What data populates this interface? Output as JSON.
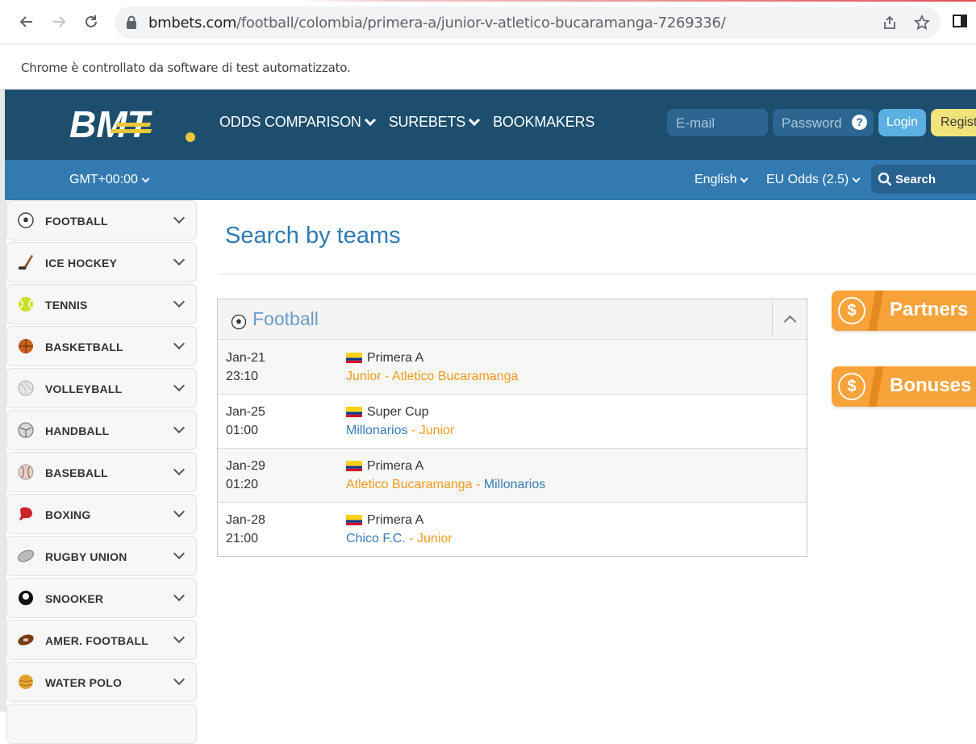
{
  "browser": {
    "url_host": "bmbets.com",
    "url_path": "/football/colombia/primera-a/junior-v-atletico-bucaramanga-7269336/",
    "automation_notice": "Chrome è controllato da software di test automatizzato."
  },
  "header": {
    "logo_text": "BMT",
    "nav": [
      {
        "label": "ODDS COMPARISON",
        "has_dropdown": true
      },
      {
        "label": "SUREBETS",
        "has_dropdown": true
      },
      {
        "label": "BOOKMAKERS",
        "has_dropdown": false
      }
    ],
    "email_placeholder": "E-mail",
    "password_placeholder": "Password",
    "help_glyph": "?",
    "login_label": "Login",
    "register_label": "Registe"
  },
  "subheader": {
    "timezone": "GMT+00:00",
    "language": "English",
    "odds_format": "EU Odds (2.5)",
    "search_label": "Search"
  },
  "sidebar": {
    "items": [
      {
        "label": "FOOTBALL",
        "icon": "soccer-ball-icon"
      },
      {
        "label": "ICE HOCKEY",
        "icon": "hockey-stick-icon"
      },
      {
        "label": "TENNIS",
        "icon": "tennis-ball-icon"
      },
      {
        "label": "BASKETBALL",
        "icon": "basketball-icon"
      },
      {
        "label": "VOLLEYBALL",
        "icon": "volleyball-icon"
      },
      {
        "label": "HANDBALL",
        "icon": "handball-icon"
      },
      {
        "label": "BASEBALL",
        "icon": "baseball-icon"
      },
      {
        "label": "BOXING",
        "icon": "boxing-glove-icon"
      },
      {
        "label": "RUGBY UNION",
        "icon": "rugby-ball-icon"
      },
      {
        "label": "SNOOKER",
        "icon": "snooker-ball-icon"
      },
      {
        "label": "AMER. FOOTBALL",
        "icon": "american-football-icon"
      },
      {
        "label": "WATER POLO",
        "icon": "water-polo-ball-icon"
      }
    ]
  },
  "main": {
    "title": "Search by teams",
    "panel_title": "Football",
    "matches": [
      {
        "date": "Jan-21",
        "time": "23:10",
        "league": "Primera A",
        "home": "Junior",
        "away": "Atletico Bucaramanga",
        "home_color": "orange",
        "away_color": "orange"
      },
      {
        "date": "Jan-25",
        "time": "01:00",
        "league": "Super Cup",
        "home": "Millonarios",
        "away": "Junior",
        "home_color": "blue",
        "away_color": "orange"
      },
      {
        "date": "Jan-29",
        "time": "01:20",
        "league": "Primera A",
        "home": "Atletico Bucaramanga",
        "away": "Millonarios",
        "home_color": "orange",
        "away_color": "blue"
      },
      {
        "date": "Jan-28",
        "time": "21:00",
        "league": "Primera A",
        "home": "Chico F.C.",
        "away": "Junior",
        "home_color": "blue",
        "away_color": "orange"
      }
    ],
    "separator": "-"
  },
  "promos": [
    {
      "label": "Partners",
      "glyph": "$"
    },
    {
      "label": "Bonuses",
      "glyph": "$"
    }
  ],
  "colors": {
    "header_dark": "#1d4e6e",
    "header_light": "#337ab1",
    "accent_orange": "#f8a23a",
    "link_blue": "#3a7ab4",
    "link_orange": "#f39a1d"
  }
}
